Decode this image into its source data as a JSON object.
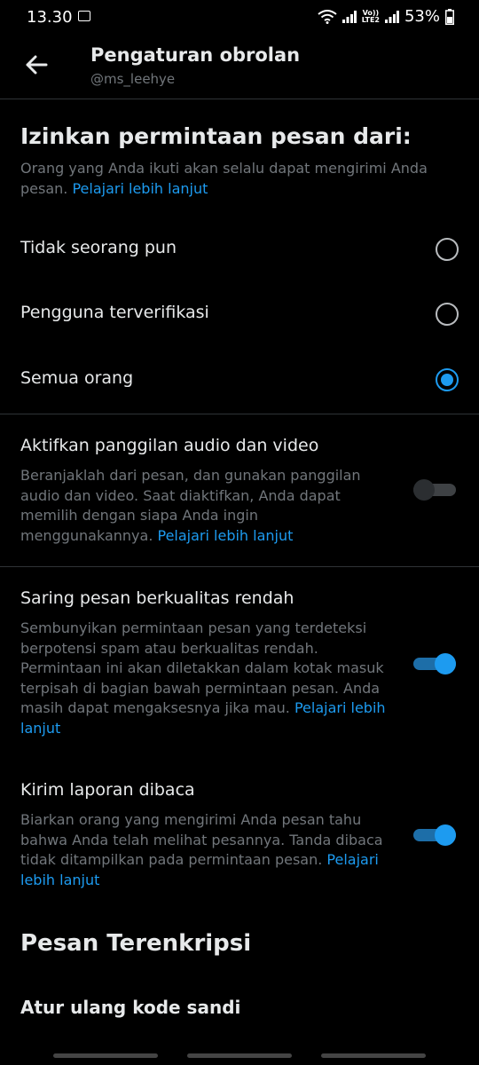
{
  "status_bar": {
    "time": "13.30",
    "volte_top": "Vo))",
    "volte_bottom": "LTE2",
    "battery": "53%"
  },
  "header": {
    "title": "Pengaturan obrolan",
    "subtitle": "@ms_leehye"
  },
  "message_requests": {
    "title": "Izinkan permintaan pesan dari:",
    "description": "Orang yang Anda ikuti akan selalu dapat mengirimi Anda pesan.",
    "link": "Pelajari lebih lanjut",
    "options": [
      {
        "label": "Tidak seorang pun",
        "selected": false
      },
      {
        "label": "Pengguna terverifikasi",
        "selected": false
      },
      {
        "label": "Semua orang",
        "selected": true
      }
    ]
  },
  "audio_video": {
    "title": "Aktifkan panggilan audio dan video",
    "description": "Beranjaklah dari pesan, dan gunakan panggilan audio dan video. Saat diaktifkan, Anda dapat memilih dengan siapa Anda ingin menggunakannya.",
    "link": "Pelajari lebih lanjut",
    "enabled": false
  },
  "quality_filter": {
    "title": "Saring pesan berkualitas rendah",
    "description": "Sembunyikan permintaan pesan yang terdeteksi berpotensi spam atau berkualitas rendah. Permintaan ini akan diletakkan dalam kotak masuk terpisah di bagian bawah permintaan pesan. Anda masih dapat mengaksesnya jika mau.",
    "link": "Pelajari lebih lanjut",
    "enabled": true
  },
  "read_receipts": {
    "title": "Kirim laporan dibaca",
    "description": "Biarkan orang yang mengirimi Anda pesan tahu bahwa Anda telah melihat pesannya. Tanda dibaca tidak ditampilkan pada permintaan pesan.",
    "link": "Pelajari lebih lanjut",
    "enabled": true
  },
  "encrypted": {
    "heading": "Pesan Terenkripsi",
    "reset_label": "Atur ulang kode sandi"
  },
  "colors": {
    "background": "#000000",
    "text": "#e7e9ea",
    "secondary": "#71767b",
    "accent": "#1d9bf0",
    "divider": "#2f3336"
  }
}
